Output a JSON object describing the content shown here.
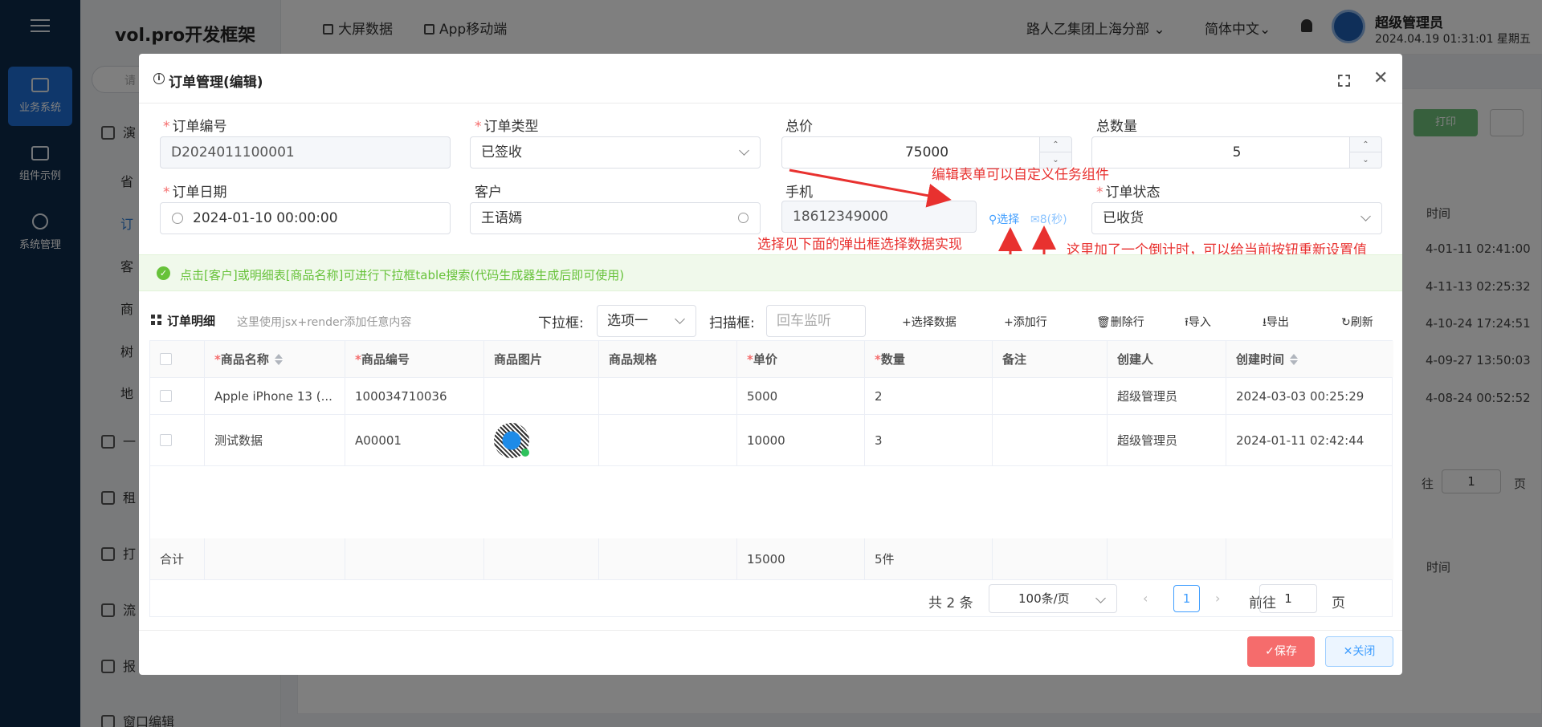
{
  "background": {
    "rail": [
      {
        "label": "业务系统",
        "active": true
      },
      {
        "label": "组件示例",
        "active": false
      },
      {
        "label": "系统管理",
        "active": false
      }
    ],
    "brand": "vol.pro开发框架",
    "search_placeholder": "请",
    "side_items": [
      {
        "label": "演",
        "sub": false
      },
      {
        "label": "省",
        "sub": true
      },
      {
        "label": "订",
        "sub": true,
        "highlight": true
      },
      {
        "label": "客",
        "sub": true
      },
      {
        "label": "商",
        "sub": true
      },
      {
        "label": "树",
        "sub": true
      },
      {
        "label": "地",
        "sub": true
      },
      {
        "label": "一",
        "sub": false
      },
      {
        "label": "租",
        "sub": false
      },
      {
        "label": "打",
        "sub": false
      },
      {
        "label": "流",
        "sub": false
      },
      {
        "label": "报",
        "sub": false
      },
      {
        "label": "窗口编辑",
        "sub": false
      }
    ],
    "top_links": [
      "大屏数据",
      "App移动端"
    ],
    "org": "路人乙集团上海分部",
    "lang": "简体中文",
    "user_name": "超级管理员",
    "user_time": "2024.04.19 01:31:01 星期五",
    "print_btn": "打印",
    "col_header": "时间",
    "times": [
      "4-01-11 02:41:00",
      "4-11-13 02:25:32",
      "4-10-24 17:24:51",
      "4-09-27 13:50:03",
      "4-08-24 00:52:52"
    ],
    "pager_goto": "往",
    "pager_page": "1",
    "pager_unit": "页",
    "col_header_2": "时间"
  },
  "dialog": {
    "title": "订单管理(编辑)",
    "fields": {
      "order_no": {
        "label": "订单编号",
        "value": "D2024011100001",
        "required": true
      },
      "order_type": {
        "label": "订单类型",
        "value": "已签收",
        "required": true
      },
      "total_price": {
        "label": "总价",
        "value": "75000"
      },
      "total_qty": {
        "label": "总数量",
        "value": "5"
      },
      "order_date": {
        "label": "订单日期",
        "value": "2024-01-10 00:00:00",
        "required": true
      },
      "customer": {
        "label": "客户",
        "value": "王语嫣"
      },
      "phone": {
        "label": "手机",
        "value": "18612349000"
      },
      "order_status": {
        "label": "订单状态",
        "value": "已收货",
        "required": true
      }
    },
    "select_link": "选择",
    "countdown_link": "8(秒)",
    "annotations": {
      "custom": "编辑表单可以自定义任务组件",
      "popup": "选择见下面的弹出框选择数据实现",
      "countdown": "这里加了一个倒计时，可以给当前按钮重新设置值"
    },
    "alert": "点击[客户]或明细表[商品名称]可进行下拉框table搜索(代码生成器生成后即可使用)",
    "detail": {
      "title": "订单明细",
      "hint": "这里使用jsx+render添加任意内容",
      "dropdown_label": "下拉框:",
      "dropdown_value": "选项一",
      "scan_label": "扫描框:",
      "scan_placeholder": "回车监听",
      "buttons": [
        "+选择数据",
        "+添加行",
        "删除行",
        "导入",
        "导出",
        "刷新"
      ]
    },
    "table": {
      "columns": [
        "商品名称",
        "商品编号",
        "商品图片",
        "商品规格",
        "单价",
        "数量",
        "备注",
        "创建人",
        "创建时间"
      ],
      "rows": [
        [
          "Apple iPhone 13 (...",
          "100034710036",
          "",
          "",
          "5000",
          "2",
          "",
          "超级管理员",
          "2024-03-03 00:25:29"
        ],
        [
          "测试数据",
          "A00001",
          "",
          "",
          "10000",
          "3",
          "",
          "超级管理员",
          "2024-01-11 02:42:44"
        ]
      ],
      "summary_label": "合计",
      "summary_price": "15000",
      "summary_qty": "5件"
    },
    "pager": {
      "total": "共 2 条",
      "page_size": "100条/页",
      "current": "1",
      "goto_label": "前往",
      "goto_value": "1",
      "unit": "页"
    },
    "save_label": "✓保存",
    "close_label": "✕关闭"
  },
  "colors": {
    "accent": "#409eff",
    "danger": "#f56c6c",
    "success": "#67c23a",
    "rail_bg": "#0d2a4a",
    "annotation": "#e8312f"
  }
}
